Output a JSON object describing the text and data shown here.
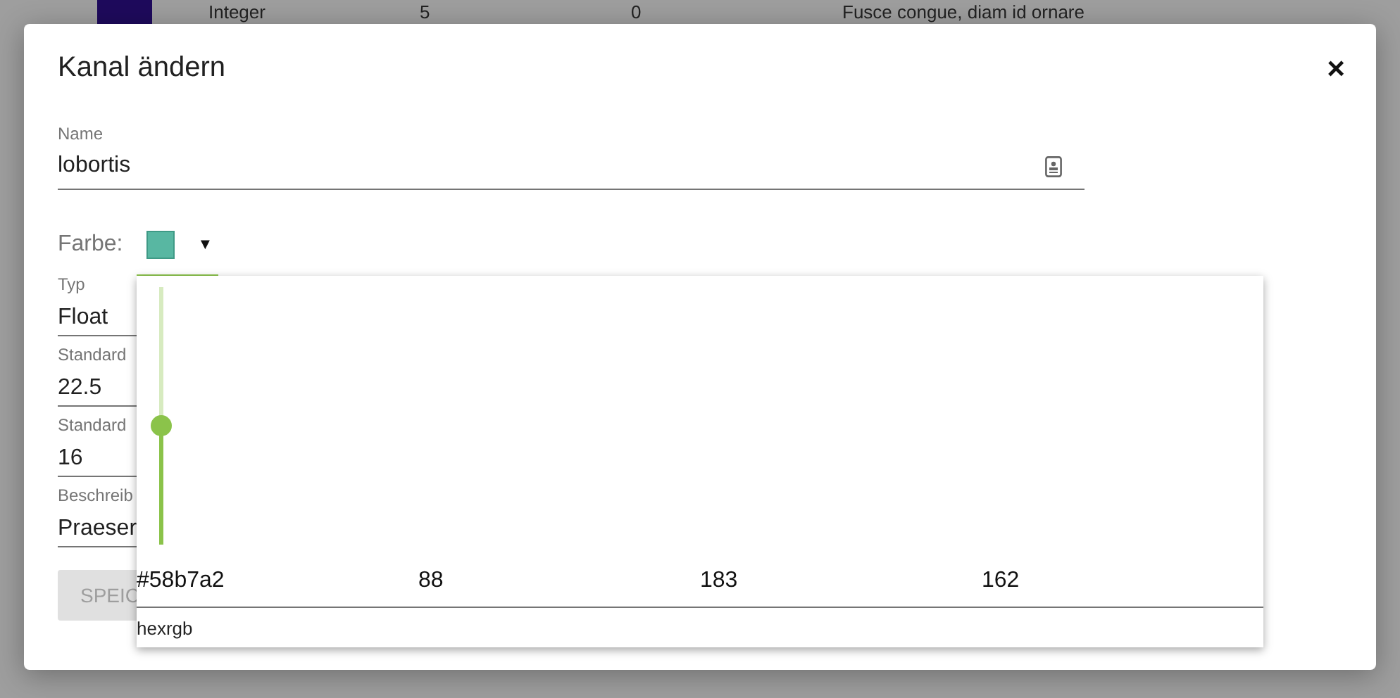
{
  "background_row": {
    "cells": [
      "Integer",
      "5",
      "0",
      "Fusce congue, diam id ornare"
    ]
  },
  "dialog": {
    "title": "Kanal ändern",
    "close": "×",
    "name_field": {
      "label": "Name",
      "value": "lobortis"
    },
    "color_field": {
      "label": "Farbe:",
      "color": "#58b7a2",
      "caret": "▼"
    },
    "fields": [
      {
        "label": "Typ",
        "value": "Float"
      },
      {
        "label": "Standard",
        "value": "22.5"
      },
      {
        "label": "Standard",
        "value": "16"
      },
      {
        "label": "Beschreib",
        "value": "Praeser"
      }
    ],
    "save_button": {
      "label": "SPEIC",
      "disabled": true
    }
  },
  "color_picker": {
    "slider": {
      "level": 0.46
    },
    "values": [
      "#58b7a2",
      "88",
      "183",
      "162"
    ],
    "mode": "hexrgb"
  }
}
